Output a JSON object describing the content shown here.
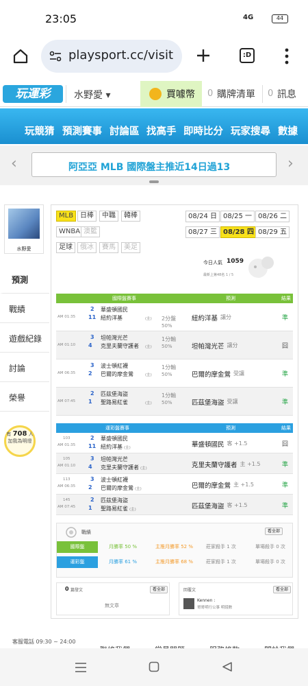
{
  "status_bar": {
    "time": "23:05",
    "network": "4G",
    "battery": "44"
  },
  "browser": {
    "url": "playsport.cc/visit",
    "tab_count": ":D"
  },
  "site_header": {
    "logo": "玩運彩",
    "user": "水野愛",
    "buy": "買噱幣",
    "cart_count": "0",
    "cart_label": "購牌清單",
    "msg_count": "0",
    "msg_label": "訊息"
  },
  "main_nav": [
    "玩競猜",
    "預測賽事",
    "討論區",
    "找高手",
    "即時比分",
    "玩家搜尋",
    "數據"
  ],
  "marquee": {
    "text": "阿亞亞 MLB 國際盤主推近14日過13"
  },
  "sidebar": {
    "username": "水野愛",
    "tabs": [
      "預測",
      "戰績",
      "遊戲紀錄",
      "討論",
      "榮譽"
    ],
    "bulb_prefix": "有",
    "bulb_count": "708",
    "bulb_suffix": "人",
    "bulb_line2": "加我為明燈"
  },
  "leagues": {
    "row1": [
      "MLB",
      "日棒",
      "中職",
      "韓棒"
    ],
    "row2": [
      "WNBA",
      "澳籃"
    ],
    "row3": [
      "足球",
      "俄冰",
      "賽馬",
      "美足"
    ]
  },
  "dates": {
    "row1": [
      "08/24 日",
      "08/25 一",
      "08/26 二"
    ],
    "row2": [
      "08/27 三",
      "08/28 四",
      "08/29 五"
    ]
  },
  "popularity": {
    "label": "今日人氣",
    "value": "1059",
    "rank": "最新上第48名 1 / 5"
  },
  "intl": {
    "headers": [
      "國際盤賽事",
      "預測",
      "結果"
    ],
    "games": [
      {
        "time": "AM 01:35",
        "n1": "2",
        "t1": "華盛頓國民",
        "n2": "11",
        "t2": "紐約洋基",
        "t2s": "(主)",
        "spread": "2分盤",
        "pct": "50%",
        "pick": "紐約洋基",
        "pick_note": "讓分",
        "result": "準"
      },
      {
        "time": "AM 01:10",
        "n1": "3",
        "t1": "坦帕灣光芒",
        "n2": "4",
        "t2": "克里夫蘭守護者",
        "t2s": "(主)",
        "spread": "1分輸",
        "pct": "50%",
        "pick": "坦帕灣光芒",
        "pick_note": "讓分",
        "result": "囧"
      },
      {
        "time": "AM 06:35",
        "n1": "3",
        "t1": "波士頓紅襪",
        "n2": "2",
        "t2": "巴爾的摩金鶯",
        "t2s": "(主)",
        "spread": "1分輸",
        "pct": "50%",
        "pick": "巴爾的摩金鶯",
        "pick_note": "受讓",
        "result": "準"
      },
      {
        "time": "AM 07:45",
        "n1": "2",
        "t1": "匹茲堡海盜",
        "n2": "1",
        "t2": "聖路易紅雀",
        "t2s": "(主)",
        "spread": "1分輸",
        "pct": "50%",
        "pick": "匹茲堡海盜",
        "pick_note": "受讓",
        "result": "準"
      }
    ]
  },
  "local": {
    "headers": [
      "運彩盤賽事",
      "預測",
      "結果"
    ],
    "games": [
      {
        "code": "103",
        "time": "AM 01:35",
        "n1": "2",
        "t1": "華盛頓國民",
        "n2": "11",
        "t2": "紐約洋基",
        "t2s": "(主)",
        "pick": "華盛頓國民",
        "pick_note": "客 +1.5",
        "result": "囧"
      },
      {
        "code": "105",
        "time": "AM 01:10",
        "n1": "3",
        "t1": "坦帕灣光芒",
        "n2": "4",
        "t2": "克里夫蘭守護者",
        "t2s": "(主)",
        "pick": "克里夫蘭守護者",
        "pick_note": "主 +1.5",
        "result": "準"
      },
      {
        "code": "113",
        "time": "AM 06:35",
        "n1": "3",
        "t1": "波士頓紅襪",
        "n2": "2",
        "t2": "巴爾的摩金鶯",
        "t2s": "(主)",
        "pick": "巴爾的摩金鶯",
        "pick_note": "主 +1.5",
        "result": "準"
      },
      {
        "code": "145",
        "time": "AM 07:45",
        "n1": "2",
        "t1": "匹茲堡海盜",
        "n2": "1",
        "t2": "聖路易紅雀",
        "t2s": "(主)",
        "pick": "匹茲堡海盜",
        "pick_note": "客 +1.5",
        "result": "準"
      }
    ]
  },
  "record": {
    "title": "戰績",
    "more": "看全部",
    "intl_label": "國際盤",
    "local_label": "運彩盤",
    "intl_stats": [
      "月勝率 50 %",
      "主推月勝率 52 %",
      "莊家殺手 1 次",
      "單場殺手 0 次"
    ],
    "local_stats": [
      "月勝率 61 %",
      "主推月勝率 68 %",
      "莊家殺手 1 次",
      "單場殺手 0 次"
    ]
  },
  "posts": {
    "count": "0",
    "label": "篇發文",
    "more": "看全部",
    "empty": "無文章"
  },
  "replies": {
    "label": "回覆文",
    "more": "看全部",
    "user": "Kennen :",
    "text": "哥哥明行公事 明錢數"
  },
  "footer": {
    "service": "客服電話 09:30 ~ 24:00",
    "links": [
      "聯絡我們",
      "常見問題",
      "服務條款",
      "關於我們"
    ]
  }
}
